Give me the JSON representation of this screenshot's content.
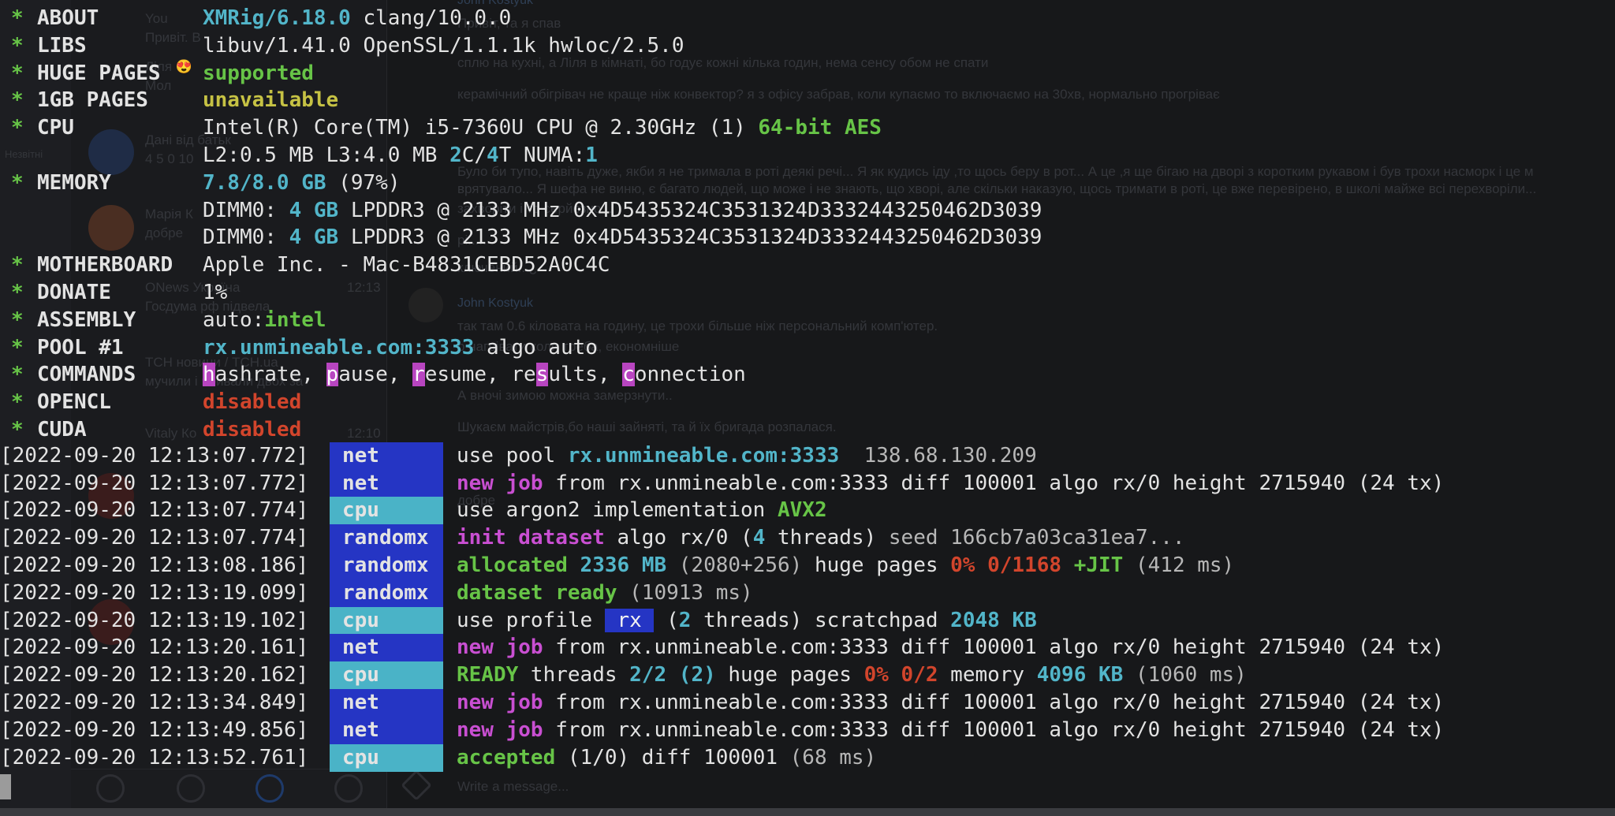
{
  "header": [
    {
      "key": "ABOUT",
      "parts": [
        {
          "t": "XMRig/6.18.0",
          "c": "cy"
        },
        {
          "t": " clang/10.0.0",
          "c": "w"
        }
      ]
    },
    {
      "key": "LIBS",
      "parts": [
        {
          "t": "libuv/1.41.0 OpenSSL/1.1.1k hwloc/2.5.0",
          "c": "w"
        }
      ]
    },
    {
      "key": "HUGE PAGES",
      "parts": [
        {
          "t": "supported",
          "c": "gn"
        }
      ]
    },
    {
      "key": "1GB PAGES",
      "parts": [
        {
          "t": "unavailable",
          "c": "yl"
        }
      ]
    },
    {
      "key": "CPU",
      "parts": [
        {
          "t": "Intel(R) Core(TM) i5-7360U CPU @ 2.30GHz (1) ",
          "c": "w"
        },
        {
          "t": "64-bit AES",
          "c": "gn"
        }
      ]
    },
    {
      "key": "",
      "parts": [
        {
          "t": "L2:0.5 MB L3:4.0 MB ",
          "c": "w"
        },
        {
          "t": "2",
          "c": "cy"
        },
        {
          "t": "C/",
          "c": "w"
        },
        {
          "t": "4",
          "c": "cy"
        },
        {
          "t": "T NUMA:",
          "c": "w"
        },
        {
          "t": "1",
          "c": "cy"
        }
      ]
    },
    {
      "key": "MEMORY",
      "parts": [
        {
          "t": "7.8/8.0 GB",
          "c": "cy"
        },
        {
          "t": " (97%)",
          "c": "w"
        }
      ]
    },
    {
      "key": "",
      "parts": [
        {
          "t": "DIMM0: ",
          "c": "w"
        },
        {
          "t": "4 GB",
          "c": "cy"
        },
        {
          "t": " LPDDR3 @ 2133 MHz 0x4D5435324C3531324D3332443250462D3039",
          "c": "w"
        }
      ]
    },
    {
      "key": "",
      "parts": [
        {
          "t": "DIMM0: ",
          "c": "w"
        },
        {
          "t": "4 GB",
          "c": "cy"
        },
        {
          "t": " LPDDR3 @ 2133 MHz 0x4D5435324C3531324D3332443250462D3039",
          "c": "w"
        }
      ]
    },
    {
      "key": "MOTHERBOARD",
      "parts": [
        {
          "t": "Apple Inc. - Mac-B4831CEBD52A0C4C",
          "c": "w"
        }
      ]
    },
    {
      "key": "DONATE",
      "parts": [
        {
          "t": "1%",
          "c": "w"
        }
      ]
    },
    {
      "key": "ASSEMBLY",
      "parts": [
        {
          "t": "auto:",
          "c": "w"
        },
        {
          "t": "intel",
          "c": "gn"
        }
      ]
    },
    {
      "key": "POOL #1",
      "parts": [
        {
          "t": "rx.unmineable.com:3333",
          "c": "cy"
        },
        {
          "t": " algo auto",
          "c": "w"
        }
      ]
    },
    {
      "key": "COMMANDS",
      "parts": [
        {
          "t": "h",
          "c": "hl"
        },
        {
          "t": "ashrate, ",
          "c": "w"
        },
        {
          "t": "p",
          "c": "hl"
        },
        {
          "t": "ause, ",
          "c": "w"
        },
        {
          "t": "r",
          "c": "hl"
        },
        {
          "t": "esume, re",
          "c": "w"
        },
        {
          "t": "s",
          "c": "hl"
        },
        {
          "t": "ults, ",
          "c": "w"
        },
        {
          "t": "c",
          "c": "hl"
        },
        {
          "t": "onnection",
          "c": "w"
        }
      ]
    },
    {
      "key": "OPENCL",
      "parts": [
        {
          "t": "disabled",
          "c": "rd"
        }
      ]
    },
    {
      "key": "CUDA",
      "parts": [
        {
          "t": "disabled",
          "c": "rd"
        }
      ]
    }
  ],
  "logs": [
    {
      "ts": "[2022-09-20 12:13:07.772]",
      "tag": "net",
      "parts": [
        {
          "t": "use pool ",
          "c": "w"
        },
        {
          "t": "rx.unmineable.com:3333 ",
          "c": "cy"
        },
        {
          "t": " 138.68.130.209",
          "c": "gy"
        }
      ]
    },
    {
      "ts": "[2022-09-20 12:13:07.772]",
      "tag": "net",
      "parts": [
        {
          "t": "new job",
          "c": "mg"
        },
        {
          "t": " from rx.unmineable.com:3333 diff ",
          "c": "w"
        },
        {
          "t": "100001",
          "c": "w"
        },
        {
          "t": " algo rx/0 height ",
          "c": "w"
        },
        {
          "t": "2715940",
          "c": "w"
        },
        {
          "t": " (24 tx)",
          "c": "w"
        }
      ]
    },
    {
      "ts": "[2022-09-20 12:13:07.774]",
      "tag": "cpu",
      "parts": [
        {
          "t": "use argon2 implementation ",
          "c": "w"
        },
        {
          "t": "AVX2",
          "c": "gn"
        }
      ]
    },
    {
      "ts": "[2022-09-20 12:13:07.774]",
      "tag": "randomx",
      "parts": [
        {
          "t": "init dataset",
          "c": "mg"
        },
        {
          "t": " algo rx/0 (",
          "c": "w"
        },
        {
          "t": "4",
          "c": "cy"
        },
        {
          "t": " threads)",
          "c": "w"
        },
        {
          "t": " seed 166cb7a03ca31ea7...",
          "c": "gy"
        }
      ]
    },
    {
      "ts": "[2022-09-20 12:13:08.186]",
      "tag": "randomx",
      "parts": [
        {
          "t": "allocated",
          "c": "gn"
        },
        {
          "t": " ",
          "c": "w"
        },
        {
          "t": "2336 MB",
          "c": "cy"
        },
        {
          "t": " (2080+256)",
          "c": "gy"
        },
        {
          "t": " huge pages ",
          "c": "w"
        },
        {
          "t": "0% 0/1168",
          "c": "rd"
        },
        {
          "t": " ",
          "c": "w"
        },
        {
          "t": "+JIT",
          "c": "gn"
        },
        {
          "t": " (412 ms)",
          "c": "gy"
        }
      ]
    },
    {
      "ts": "[2022-09-20 12:13:19.099]",
      "tag": "randomx",
      "parts": [
        {
          "t": "dataset ready",
          "c": "gn"
        },
        {
          "t": " (10913 ms)",
          "c": "gy"
        }
      ]
    },
    {
      "ts": "[2022-09-20 12:13:19.102]",
      "tag": "cpu",
      "parts": [
        {
          "t": "use profile ",
          "c": "w"
        },
        {
          "t": " rx ",
          "c": "rx-box"
        },
        {
          "t": " (",
          "c": "w"
        },
        {
          "t": "2",
          "c": "cy"
        },
        {
          "t": " threads) scratchpad ",
          "c": "w"
        },
        {
          "t": "2048 KB",
          "c": "cy"
        }
      ]
    },
    {
      "ts": "[2022-09-20 12:13:20.161]",
      "tag": "net",
      "parts": [
        {
          "t": "new job",
          "c": "mg"
        },
        {
          "t": " from rx.unmineable.com:3333 diff ",
          "c": "w"
        },
        {
          "t": "100001",
          "c": "w"
        },
        {
          "t": " algo rx/0 height ",
          "c": "w"
        },
        {
          "t": "2715940",
          "c": "w"
        },
        {
          "t": " (24 tx)",
          "c": "w"
        }
      ]
    },
    {
      "ts": "[2022-09-20 12:13:20.162]",
      "tag": "cpu",
      "parts": [
        {
          "t": "READY",
          "c": "gn"
        },
        {
          "t": " threads ",
          "c": "w"
        },
        {
          "t": "2/2 (2)",
          "c": "cy"
        },
        {
          "t": " huge pages ",
          "c": "w"
        },
        {
          "t": "0% 0/2",
          "c": "rd"
        },
        {
          "t": " memory ",
          "c": "w"
        },
        {
          "t": "4096 KB",
          "c": "cy"
        },
        {
          "t": " (1060 ms)",
          "c": "gy"
        }
      ]
    },
    {
      "ts": "[2022-09-20 12:13:34.849]",
      "tag": "net",
      "parts": [
        {
          "t": "new job",
          "c": "mg"
        },
        {
          "t": " from rx.unmineable.com:3333 diff ",
          "c": "w"
        },
        {
          "t": "100001",
          "c": "w"
        },
        {
          "t": " algo rx/0 height ",
          "c": "w"
        },
        {
          "t": "2715940",
          "c": "w"
        },
        {
          "t": " (24 tx)",
          "c": "w"
        }
      ]
    },
    {
      "ts": "[2022-09-20 12:13:49.856]",
      "tag": "net",
      "parts": [
        {
          "t": "new job",
          "c": "mg"
        },
        {
          "t": " from rx.unmineable.com:3333 diff ",
          "c": "w"
        },
        {
          "t": "100001",
          "c": "w"
        },
        {
          "t": " algo rx/0 height ",
          "c": "w"
        },
        {
          "t": "2715940",
          "c": "w"
        },
        {
          "t": " (24 tx)",
          "c": "w"
        }
      ]
    },
    {
      "ts": "[2022-09-20 12:13:52.761]",
      "tag": "cpu",
      "parts": [
        {
          "t": "accepted",
          "c": "gn"
        },
        {
          "t": " (1/0) diff ",
          "c": "w"
        },
        {
          "t": "100001",
          "c": "w"
        },
        {
          "t": " (68 ms)",
          "c": "gy"
        }
      ]
    }
  ],
  "background": {
    "chat_list": [
      {
        "name": "You",
        "preview": "Привіт. В"
      },
      {
        "name": "Ліля 😍",
        "preview": "Мол"
      },
      {
        "name": "Дані від батьк",
        "preview": "4 5 0 10"
      },
      {
        "name": "Марія К",
        "preview": "добре"
      },
      {
        "name": "ONews Україна",
        "preview": "Госдума рф підвела"
      },
      {
        "name": "ТСН новини / ТСН.ua",
        "preview": "мучили і вбивали двох за"
      },
      {
        "name": "Vitaly Ко",
        "preview": ""
      }
    ],
    "list_times": [
      "12:13",
      "12:10"
    ],
    "messages": [
      {
        "name": "John Kostyuk",
        "text": "Привіт, та я спав"
      },
      {
        "name": "",
        "text": "сплю на кухні, а Ліля в кімнаті, бо годує кожні кілька годин, нема сенсу обом не спати"
      },
      {
        "name": "",
        "text": "керамічний обігрівач не краще ніж конвектор? я з офісу забрав, коли купаємо то включаємо на 30хв, нормально прогріває"
      },
      {
        "name": "",
        "text": "Було би тупо, навіть дуже, якби я не тримала в роті деякі речі... Я як кудись іду ,то щось беру в рот... А це ,я ще бігаю на дворі з коротким рукавом і був трохи насморк і це м"
      },
      {
        "name": "",
        "text": "врятувало... Я шефа не виню, є багато людей, що може і не знають, що хворі, але скільки наказую, щось тримати в роті, це вже перевірено, в школі майже всі перехворіли..."
      },
      {
        "name": "",
        "text": "захворіти і то серйозно..."
      },
      {
        "name": "",
        "text": "рі....."
      },
      {
        "name": "",
        "text": "ключений...¿"
      },
      {
        "name": "John Kostyuk",
        "text": "так там 0.6 кіловата на годину, це трохи більше ніж персональний комп'ютер."
      },
      {
        "name": "",
        "text": "о нагрівати коли треба, економніше"
      },
      {
        "name": "",
        "text": "А вночі зимою можна замерзнути.."
      },
      {
        "name": "",
        "text": "Шукаєм майстрів,бо наші зайняті, та й їх бригада розпалася."
      },
      {
        "name": "",
        "text": "добре"
      }
    ],
    "compose_placeholder": "Write a message...",
    "sidebar_label": "Незвітні"
  },
  "colors": {
    "net": "#2535c4",
    "randomx": "#2535c4",
    "cpu": "#4ab3c7",
    "accent_cyan": "#52b5c9",
    "accent_green": "#67c447",
    "accent_magenta": "#c94fd2",
    "accent_red": "#d2452c"
  }
}
